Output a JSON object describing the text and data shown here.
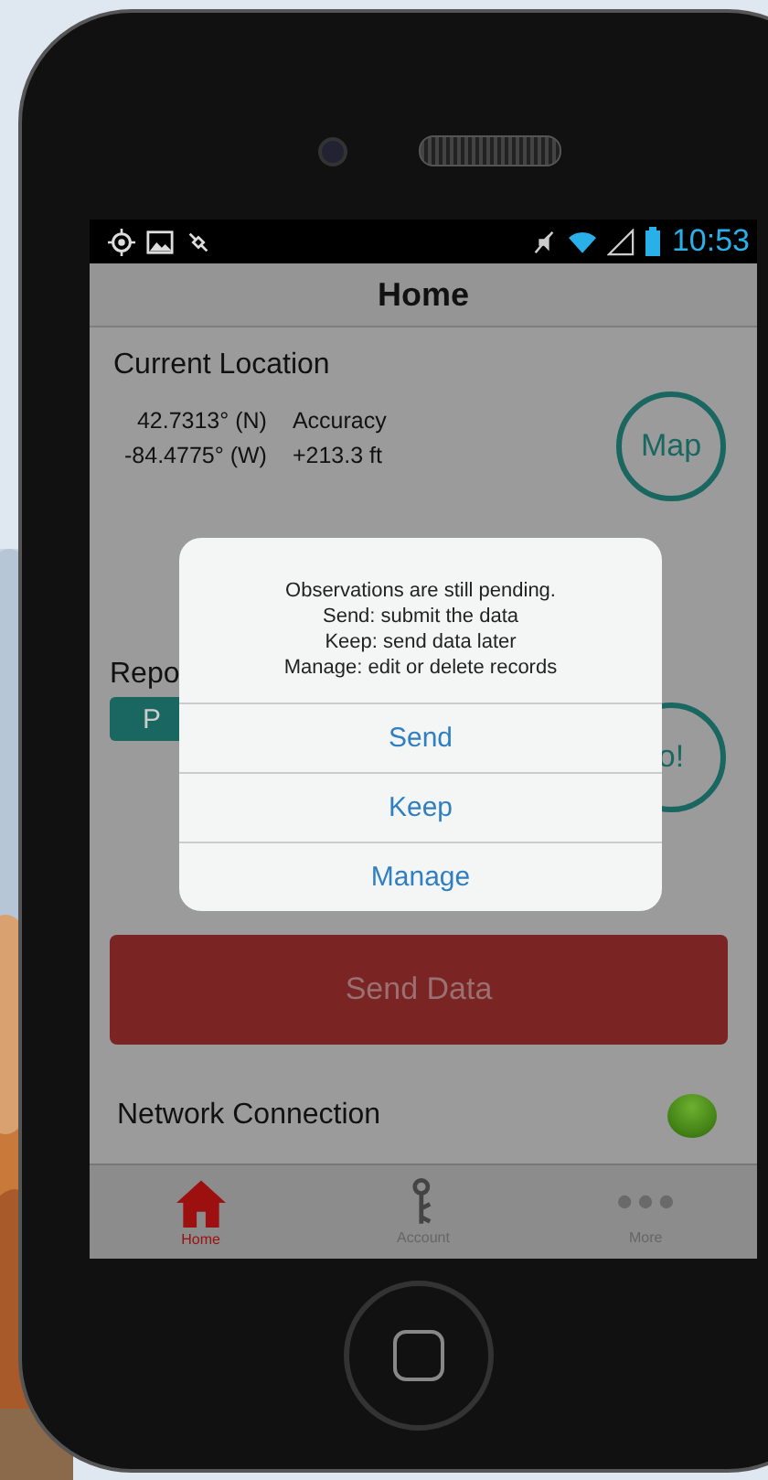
{
  "status_bar": {
    "time": "10:53"
  },
  "header": {
    "title": "Home"
  },
  "location": {
    "title": "Current Location",
    "latitude": "42.7313° (N)",
    "longitude": "-84.4775° (W)",
    "accuracy_label": "Accuracy",
    "accuracy_value": "+213.3 ft",
    "map_button": "Map"
  },
  "report": {
    "title": "Repo",
    "button": "P",
    "go_button": "o!"
  },
  "send_button": "Send Data",
  "network": {
    "label": "Network Connection",
    "connected": true
  },
  "tabs": [
    {
      "label": "Home",
      "selected": true
    },
    {
      "label": "Account",
      "selected": false
    },
    {
      "label": "More",
      "selected": false
    }
  ],
  "dialog": {
    "message_lines": [
      "Observations are still pending.",
      "Send: submit the data",
      "Keep: send data later",
      "Manage: edit or delete records"
    ],
    "buttons": [
      "Send",
      "Keep",
      "Manage"
    ]
  }
}
